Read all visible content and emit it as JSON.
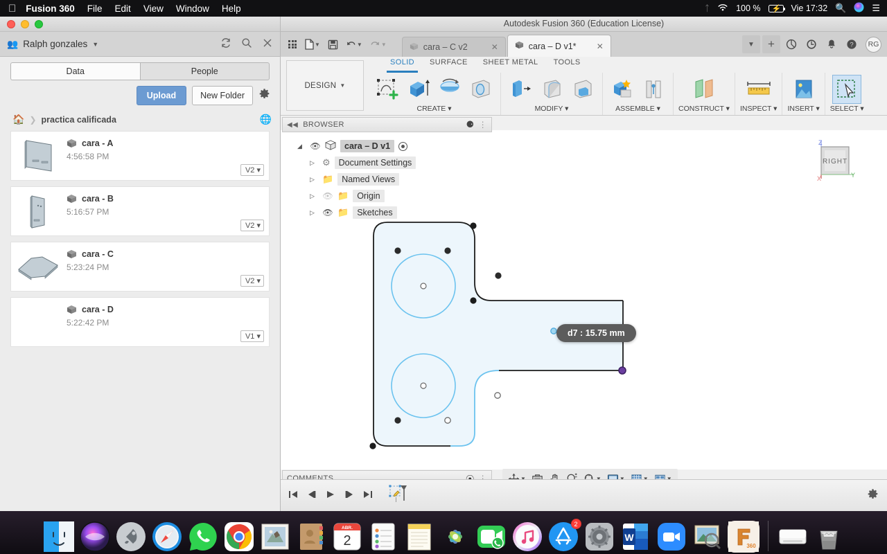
{
  "macbar": {
    "apple": "apple-logo",
    "app_name": "Fusion 360",
    "menus": [
      "File",
      "Edit",
      "View",
      "Window",
      "Help"
    ],
    "battery_pct": "100 %",
    "clock": "Vie 17:32"
  },
  "data_panel": {
    "user_name": "Ralph gonzales",
    "tabs": [
      {
        "label": "Data",
        "active": true
      },
      {
        "label": "People",
        "active": false
      }
    ],
    "upload_label": "Upload",
    "new_folder_label": "New Folder",
    "breadcrumb": "practica calificada",
    "items": [
      {
        "name": "cara - A",
        "time": "4:56:58 PM",
        "version": "V2"
      },
      {
        "name": "cara - B",
        "time": "5:16:57 PM",
        "version": "V2"
      },
      {
        "name": "cara - C",
        "time": "5:23:24 PM",
        "version": "V2"
      },
      {
        "name": "cara - D",
        "time": "5:22:42 PM",
        "version": "V1"
      }
    ]
  },
  "fusion": {
    "window_title": "Autodesk Fusion 360 (Education License)",
    "doc_tabs": [
      {
        "label": "cara – C v2",
        "active": false
      },
      {
        "label": "cara – D v1*",
        "active": true
      }
    ],
    "avatar_initials": "RG",
    "design_label": "DESIGN",
    "workspace_tabs": [
      {
        "label": "SOLID",
        "active": true
      },
      {
        "label": "SURFACE",
        "active": false
      },
      {
        "label": "SHEET METAL",
        "active": false
      },
      {
        "label": "TOOLS",
        "active": false
      }
    ],
    "ribbon_groups": [
      {
        "label": "CREATE",
        "commands": [
          "create-sketch-icon",
          "extrude-icon",
          "revolve-icon",
          "hole-icon"
        ]
      },
      {
        "label": "MODIFY",
        "commands": [
          "press-pull-icon",
          "fillet-icon",
          "shell-icon"
        ]
      },
      {
        "label": "ASSEMBLE",
        "commands": [
          "new-component-icon",
          "joint-icon"
        ]
      },
      {
        "label": "CONSTRUCT",
        "commands": [
          "offset-plane-icon"
        ]
      },
      {
        "label": "INSPECT",
        "commands": [
          "measure-icon"
        ]
      },
      {
        "label": "INSERT",
        "commands": [
          "insert-image-icon"
        ]
      },
      {
        "label": "SELECT",
        "commands": [
          "select-window-icon"
        ]
      }
    ],
    "browser": {
      "title": "BROWSER",
      "nodes": [
        {
          "label": "cara – D v1",
          "depth": 0,
          "eye": "on",
          "type": "root"
        },
        {
          "label": "Document Settings",
          "depth": 1,
          "eye": "none",
          "type": "gear"
        },
        {
          "label": "Named Views",
          "depth": 1,
          "eye": "none",
          "type": "folder"
        },
        {
          "label": "Origin",
          "depth": 1,
          "eye": "off",
          "type": "folder"
        },
        {
          "label": "Sketches",
          "depth": 1,
          "eye": "on",
          "type": "folder"
        }
      ]
    },
    "canvas": {
      "dimension_tooltip": "d7 : 15.75 mm",
      "viewcube_face": "RIGHT",
      "axis_x": "X",
      "axis_y": "Y",
      "axis_z": "Z"
    },
    "comments_title": "COMMENTS",
    "nav_icons": [
      "orbit-icon",
      "look-at-icon",
      "pan-icon",
      "zoom-icon",
      "zoom-window-icon",
      "display-settings-icon",
      "grid-snaps-icon",
      "viewports-icon"
    ],
    "timeline_icons": [
      "go-to-beginning-icon",
      "step-back-icon",
      "play-icon",
      "step-forward-icon",
      "go-to-end-icon",
      "sketch-feature-icon"
    ],
    "timeline_settings": "gear-icon"
  },
  "dock": {
    "items": [
      {
        "name": "finder-icon",
        "running": true
      },
      {
        "name": "siri-icon",
        "running": false
      },
      {
        "name": "launchpad-icon",
        "running": false
      },
      {
        "name": "safari-icon",
        "running": false
      },
      {
        "name": "whatsapp-icon",
        "running": true
      },
      {
        "name": "chrome-icon",
        "running": false
      },
      {
        "name": "mail-icon",
        "running": false
      },
      {
        "name": "contacts-icon",
        "running": false
      },
      {
        "name": "calendar-icon",
        "running": false,
        "label": "ABR.",
        "day": "2"
      },
      {
        "name": "reminders-icon",
        "running": false
      },
      {
        "name": "notes-icon",
        "running": false
      },
      {
        "name": "photos-icon",
        "running": false
      },
      {
        "name": "facetime-icon",
        "running": false
      },
      {
        "name": "itunes-icon",
        "running": false
      },
      {
        "name": "app-store-icon",
        "running": false,
        "badge": "2"
      },
      {
        "name": "system-preferences-icon",
        "running": false
      },
      {
        "name": "microsoft-word-icon",
        "running": true
      },
      {
        "name": "zoom-icon",
        "running": false
      },
      {
        "name": "preview-icon",
        "running": false
      },
      {
        "name": "fusion-360-icon",
        "running": true,
        "label": "360"
      },
      {
        "name": "disk-icon",
        "running": false
      },
      {
        "name": "trash-icon",
        "running": false
      }
    ]
  },
  "colors": {
    "accent_blue": "#2a7fbe",
    "upload_blue": "#6c9bd2",
    "sketch_line": "#6cc3ef",
    "sketch_fill": "#edf6fc",
    "tooltip_bg": "#5c5c5c",
    "selected_point": "#6b3fa0"
  }
}
